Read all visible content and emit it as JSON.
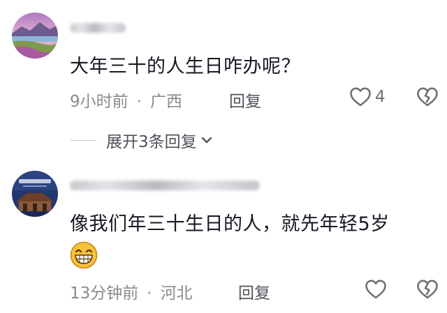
{
  "comments": [
    {
      "text": "大年三十的人生日咋办呢？",
      "time": "9小时前",
      "location": "广西",
      "reply_label": "回复",
      "like_count": "4",
      "expand_label": "展开3条回复"
    },
    {
      "text": "像我们年三十生日的人，就先年轻5岁",
      "emoji": "grinning-face",
      "time": "13分钟前",
      "location": "河北",
      "reply_label": "回复",
      "like_count": ""
    }
  ],
  "separator": "·",
  "colors": {
    "text": "#161823",
    "meta": "#8a8b91",
    "action": "#505259",
    "icon": "#6f7077"
  }
}
